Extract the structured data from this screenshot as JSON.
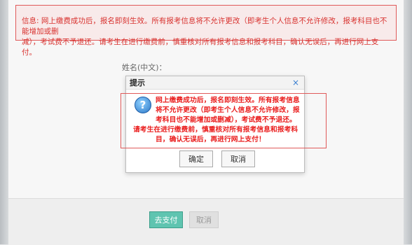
{
  "notice": {
    "line1": "信息: 网上缴费成功后，报名即刻生效。所有报考信息将不允许更改（即考生个人信息不允许修改，报考科目也不能增加或删",
    "line2": "减），考试费不予退还。请考生在进行缴费前，慎重核对所有报考信息和报考科目，确认无误后，再进行网上支付。"
  },
  "form": {
    "name_label": "姓名(中文)："
  },
  "dialog": {
    "title": "提示",
    "close_symbol": "×",
    "icon_symbol": "?",
    "lines": [
      "网上缴费成功后，报名即刻生效。所有报考信息",
      "将不允许更改（即考生个人信息不允许修改，报",
      "考科目也不能增加或删减），考试费不予退还。",
      "请考生在进行缴费前，慎重核对所有报考信息和报考科",
      "目，确认无误后，再进行网上支付！"
    ],
    "ok_label": "确定",
    "cancel_label": "取消"
  },
  "footer": {
    "pay_label": "去支付",
    "cancel_label": "取消"
  },
  "colors": {
    "alert_red": "#ea1d1d",
    "frame_red": "#e05a5a",
    "pay_teal": "#5fc4b0"
  }
}
